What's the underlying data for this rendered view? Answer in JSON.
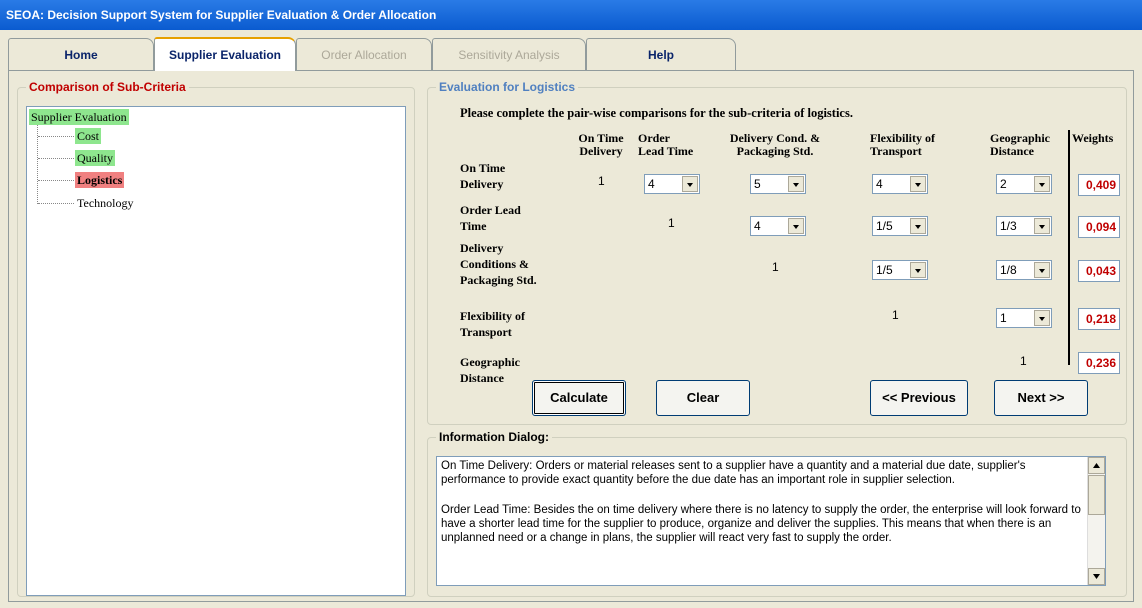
{
  "window": {
    "title": "SEOA: Decision Support System for Supplier Evaluation & Order Allocation"
  },
  "tabs": [
    {
      "label": "Home",
      "state": "normal"
    },
    {
      "label": "Supplier Evaluation",
      "state": "active"
    },
    {
      "label": "Order Allocation",
      "state": "disabled"
    },
    {
      "label": "Sensitivity Analysis",
      "state": "disabled"
    },
    {
      "label": "Help",
      "state": "normal"
    }
  ],
  "left_panel": {
    "title": "Comparison of Sub-Criteria",
    "tree": {
      "root": "Supplier Evaluation",
      "children": [
        "Cost",
        "Quality",
        "Logistics",
        "Technology"
      ]
    },
    "colors": {
      "done": "#8ee68e",
      "selected": "#f08080"
    }
  },
  "evaluation": {
    "title": "Evaluation for Logistics",
    "instruction": "Please complete the pair-wise comparisons for the sub-criteria of logistics.",
    "col_headers": [
      [
        "On Time",
        "Delivery"
      ],
      [
        "Order",
        "Lead Time"
      ],
      [
        "Delivery Cond. &",
        "Packaging Std."
      ],
      [
        "Flexibility of",
        "Transport"
      ],
      [
        "Geographic",
        "Distance"
      ]
    ],
    "weights_header": "Weights",
    "rows": [
      {
        "label": [
          "On Time",
          "Delivery"
        ],
        "diag": "1",
        "values": [
          "4",
          "5",
          "4",
          "2"
        ],
        "weight": "0,409"
      },
      {
        "label": [
          "Order Lead",
          "Time"
        ],
        "diag": "1",
        "values": [
          "4",
          "1/5",
          "1/3"
        ],
        "weight": "0,094"
      },
      {
        "label": [
          "Delivery",
          "Conditions &",
          "Packaging Std."
        ],
        "diag": "1",
        "values": [
          "1/5",
          "1/8"
        ],
        "weight": "0,043"
      },
      {
        "label": [
          "Flexibility of",
          "Transport"
        ],
        "diag": "1",
        "values": [
          "1"
        ],
        "weight": "0,218"
      },
      {
        "label": [
          "Geographic",
          "Distance"
        ],
        "diag": "1",
        "values": [],
        "weight": "0,236"
      }
    ],
    "buttons": {
      "calculate": "Calculate",
      "clear": "Clear",
      "previous": "<< Previous",
      "next": "Next >>"
    }
  },
  "info": {
    "title": "Information Dialog:",
    "paragraphs": [
      "On Time Delivery: Orders or material releases sent to a supplier have a quantity and a material due date, supplier's performance to provide exact quantity before the due date has an important role in supplier selection.",
      "Order Lead Time: Besides the on time delivery where there is no latency to supply the order, the enterprise will look forward to have a shorter lead time for the supplier to produce, organize and deliver the supplies. This means that when there is an unplanned need or a change in plans, the supplier will react very fast to supply the order."
    ]
  }
}
